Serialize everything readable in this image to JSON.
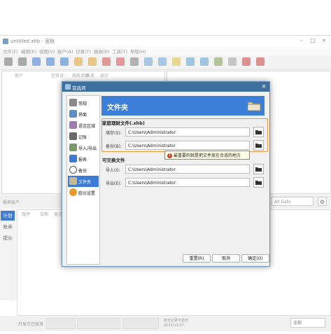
{
  "window": {
    "title": "untitled.xhb - 家账",
    "buttons": [
      "–",
      "□",
      "×"
    ]
  },
  "menu": [
    "文件(F)",
    "编辑(E)",
    "视图(V)",
    "账户(A)",
    "记录(T)",
    "报表(R)",
    "工具(T)",
    "帮助(H)"
  ],
  "toolbar_colors": [
    "#6b6b6b",
    "#6b6b6b",
    "#3d7bd4",
    "#3d7bd4",
    "#3d7bd4",
    "#e0a030",
    "#e0a030",
    "#d05050",
    "#d05050",
    "#7a7a7a",
    "#6a9fd8",
    "#6a9fd8",
    "#e0c040",
    "#5a9fd0",
    "#5a9fd0",
    "#7aa050",
    "#a0a0a0",
    "#c84040",
    "#c84040"
  ],
  "leftpane": {
    "columns": [
      "账户",
      "已核对",
      "现有余额",
      "未来",
      "总计"
    ]
  },
  "midbar": {
    "label": "报表账户",
    "dropdown": "All Date"
  },
  "bottom": {
    "tabs": [
      "计划",
      "账单",
      "提示"
    ],
    "header": [
      "暂停",
      "日期",
      "备注"
    ]
  },
  "statusbar": {
    "left": "只显示已核准",
    "center_a": "暂无记录可显示",
    "center_b": "2021/12/17",
    "right": "全部"
  },
  "dialog": {
    "title": "首选项",
    "nav": [
      "常规",
      "界面",
      "语言区域",
      "记账",
      "导入/导出",
      "报表",
      "备份",
      "文件夹",
      "欧元设置"
    ],
    "selected_nav": 7,
    "header": "文件夹",
    "group1": {
      "title": "家庭理财文件(.xhb)",
      "fields": [
        {
          "label": "储存(S):",
          "value": "C:\\Users\\Administrator"
        },
        {
          "label": "备份(B):",
          "value": "C:\\Users\\Administrator"
        }
      ]
    },
    "tooltip": "最重要的就是把文件放在合适的地方",
    "tooltip_badge": "1",
    "group2": {
      "title": "可交换文件",
      "fields": [
        {
          "label": "导入(I):",
          "value": "C:\\Users\\Administrator"
        },
        {
          "label": "导出(E):",
          "value": "C:\\Users\\Administrator"
        }
      ]
    },
    "buttons": {
      "reset": "重置(R)",
      "cancel": "取消",
      "ok": "确定(O)"
    }
  }
}
